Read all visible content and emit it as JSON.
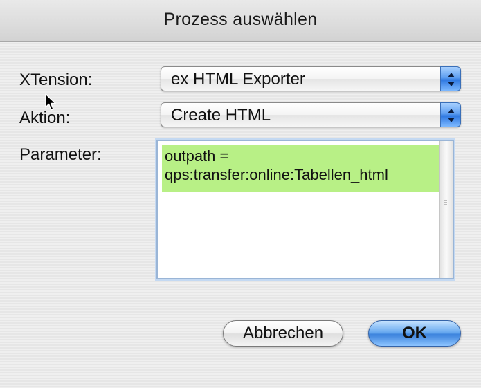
{
  "dialog": {
    "title": "Prozess auswählen"
  },
  "form": {
    "xtension_label": "XTension:",
    "xtension_value": "ex HTML Exporter",
    "aktion_label": "Aktion:",
    "aktion_value": "Create HTML",
    "parameter_label": "Parameter:",
    "parameter_value": "outpath =\nqps:transfer:online:Tabellen_html"
  },
  "buttons": {
    "cancel_label": "Abbrechen",
    "ok_label": "OK"
  },
  "icons": {
    "popup_arrows": "up-down-arrows-icon",
    "cursor": "mouse-pointer-icon"
  },
  "colors": {
    "selection_highlight": "#b8f086",
    "aqua_blue": "#3b82dc"
  }
}
